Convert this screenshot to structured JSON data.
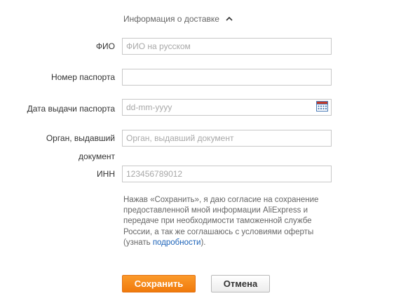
{
  "section": {
    "title": "Информация о доставке",
    "toggle_icon": "chevron-up-icon"
  },
  "form": {
    "fio": {
      "label": "ФИО",
      "value": "",
      "placeholder": "ФИО на русском"
    },
    "passport": {
      "label": "Номер паспорта",
      "value": "",
      "placeholder": ""
    },
    "issue_date": {
      "label": "Дата выдачи паспорта",
      "value": "",
      "placeholder": "dd-mm-yyyy",
      "icon": "calendar-icon"
    },
    "issuer": {
      "label_line1": "Орган, выдавший",
      "label_line2": "документ",
      "value": "",
      "placeholder": "Орган, выдавший документ"
    },
    "inn": {
      "label": "ИНН",
      "value": "",
      "placeholder": "123456789012"
    }
  },
  "consent": {
    "text_before": "Нажав «Сохранить», я даю согласие на сохранение предоставленной мной информации AliExpress и передаче при необходимости таможенной службе России, а так же соглашаюсь с условиями оферты (узнать ",
    "link_text": "подробности",
    "text_after": ")."
  },
  "buttons": {
    "save_label": "Сохранить",
    "cancel_label": "Отмена"
  },
  "colors": {
    "accent_orange": "#f5861f",
    "link_blue": "#1b62b8",
    "field_border": "#c8c8c8",
    "placeholder": "#a8a8a8"
  }
}
